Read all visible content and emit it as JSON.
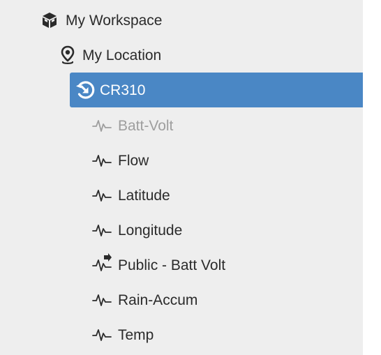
{
  "tree": {
    "workspace": {
      "label": "My Workspace",
      "icon": "boxes-icon"
    },
    "location": {
      "label": "My Location",
      "icon": "map-pin-icon"
    },
    "station": {
      "label": "CR310",
      "icon": "station-sync-icon",
      "selected": true
    },
    "items": [
      {
        "label": "Batt-Volt",
        "icon": "pulse-icon",
        "disabled": true
      },
      {
        "label": "Flow",
        "icon": "pulse-icon"
      },
      {
        "label": "Latitude",
        "icon": "pulse-icon"
      },
      {
        "label": "Longitude",
        "icon": "pulse-icon"
      },
      {
        "label": "Public - Batt Volt",
        "icon": "pulse-forward-icon"
      },
      {
        "label": "Rain-Accum",
        "icon": "pulse-icon"
      },
      {
        "label": "Temp",
        "icon": "pulse-icon"
      }
    ]
  },
  "colors": {
    "panel_bg": "#eeeeee",
    "selected_bg": "#4a87c5",
    "text": "#2b2b2b",
    "disabled_text": "#9e9e9e"
  }
}
